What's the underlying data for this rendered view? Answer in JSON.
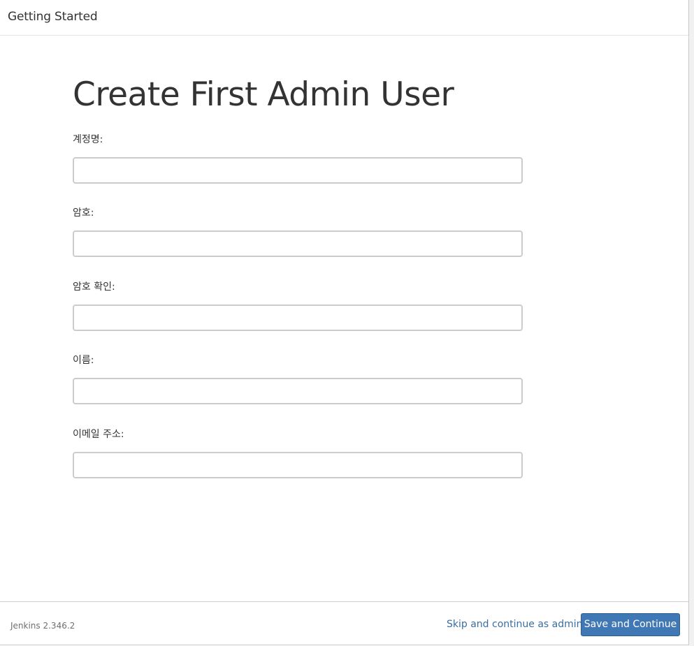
{
  "header": {
    "title": "Getting Started"
  },
  "main": {
    "title": "Create First Admin User",
    "fields": [
      {
        "label": "계정명:",
        "value": "",
        "placeholder": ""
      },
      {
        "label": "암호:",
        "value": "",
        "placeholder": ""
      },
      {
        "label": "암호 확인:",
        "value": "",
        "placeholder": ""
      },
      {
        "label": "이름:",
        "value": "",
        "placeholder": ""
      },
      {
        "label": "이메일 주소:",
        "value": "",
        "placeholder": ""
      }
    ]
  },
  "footer": {
    "version": "Jenkins 2.346.2",
    "skip_label": "Skip and continue as admin",
    "save_label": "Save and Continue"
  },
  "colors": {
    "primary_button": "#3f78b5",
    "link": "#3a6da3",
    "text": "#333333",
    "input_border": "#cccccc"
  }
}
